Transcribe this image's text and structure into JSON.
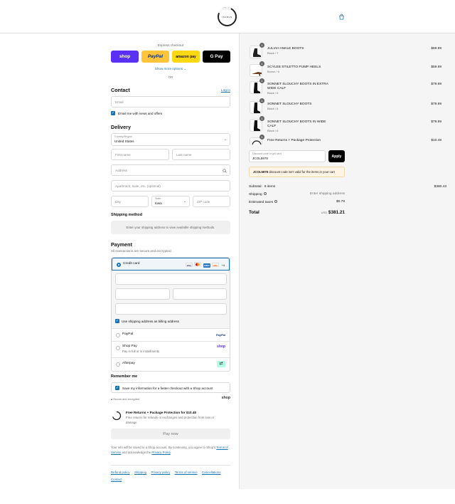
{
  "header": {
    "logo_text": "ISURUS",
    "cart_icon": "bag-icon"
  },
  "express": {
    "label": "Express checkout",
    "buttons": [
      "shop",
      "PayPal",
      "amazon pay",
      "G Pay"
    ],
    "show_more": "Show more options ⌄",
    "or": "OR"
  },
  "contact": {
    "title": "Contact",
    "login": "Log in",
    "email_placeholder": "Email",
    "newsletter": "Email me with news and offers"
  },
  "delivery": {
    "title": "Delivery",
    "country_label": "Country/Region",
    "country_value": "United States",
    "first_name": "First name",
    "last_name": "Last name",
    "address": "Address",
    "apartment": "Apartment, suite, etc. (optional)",
    "city": "City",
    "state_label": "State",
    "state_value": "Iowa",
    "zip": "ZIP code"
  },
  "shipping": {
    "title": "Shipping method",
    "message": "Enter your shipping address to view available shipping methods."
  },
  "payment": {
    "title": "Payment",
    "subtitle": "All transactions are secure and encrypted.",
    "credit_card": "Credit card",
    "card_more": "+4",
    "billing_same": "Use shipping address as billing address",
    "paypal": "PayPal",
    "shop_pay": "Shop Pay",
    "shop_pay_sub": "Pay in full or in installments",
    "afterpay": "Afterpay"
  },
  "remember": {
    "title": "Remember me",
    "save_info": "Save my information for a faster checkout with a Shop account",
    "secure": "Secure and encrypted",
    "shop_logo": "shop"
  },
  "protection": {
    "title": "Free Returns + Package Protection for $10.48",
    "desc": "Free returns for refunds or exchanges and protection from loss or damage"
  },
  "pay_now": "Pay now",
  "terms": {
    "text1": "Your info will be saved to a Shop account. By continuing, you agree to Shop's",
    "terms_link": "Terms of Service",
    "text2": "and acknowledge the",
    "privacy_link": "Privacy Policy",
    "text3": "."
  },
  "footer_links": [
    "Refund policy",
    "Shipping",
    "Privacy policy",
    "Terms of service",
    "Cancellations",
    "Contact"
  ],
  "order": {
    "items": [
      {
        "qty": "1",
        "name": "JULIAH ANKLE BOOTS",
        "variant": "Black / 7",
        "price": "$69.99"
      },
      {
        "qty": "1",
        "name": "SCYLEE STILETTO PUMP HEELS",
        "variant": "Brown / 6",
        "price": "$59.99"
      },
      {
        "qty": "1",
        "name": "SONNET SLOUCHY BOOTS IN EXTRA WIDE CALF",
        "variant": "Black / 6",
        "price": "$79.99"
      },
      {
        "qty": "1",
        "name": "SONNET SLOUCHY BOOTS",
        "variant": "Black / 6",
        "price": "$79.99"
      },
      {
        "qty": "1",
        "name": "SONNET SLOUCHY BOOTS IN WIDE CALF",
        "variant": "Black / 6",
        "price": "$79.99"
      },
      {
        "qty": "1",
        "name": "Free Returns + Package Protection",
        "variant": "",
        "price": "$10.48"
      }
    ],
    "discount_label": "Discount code or gift card",
    "discount_value": "JCOL5978",
    "apply": "Apply",
    "warning_code": "JCOL5978",
    "warning_text": "discount code isn't valid for the items in your cart",
    "subtotal_label": "Subtotal · 6 items",
    "subtotal_value": "$380.43",
    "shipping_label": "Shipping",
    "shipping_value": "Enter shipping address",
    "taxes_label": "Estimated taxes",
    "taxes_value": "$0.78",
    "total_label": "Total",
    "currency": "USD",
    "total_value": "$381.21"
  }
}
